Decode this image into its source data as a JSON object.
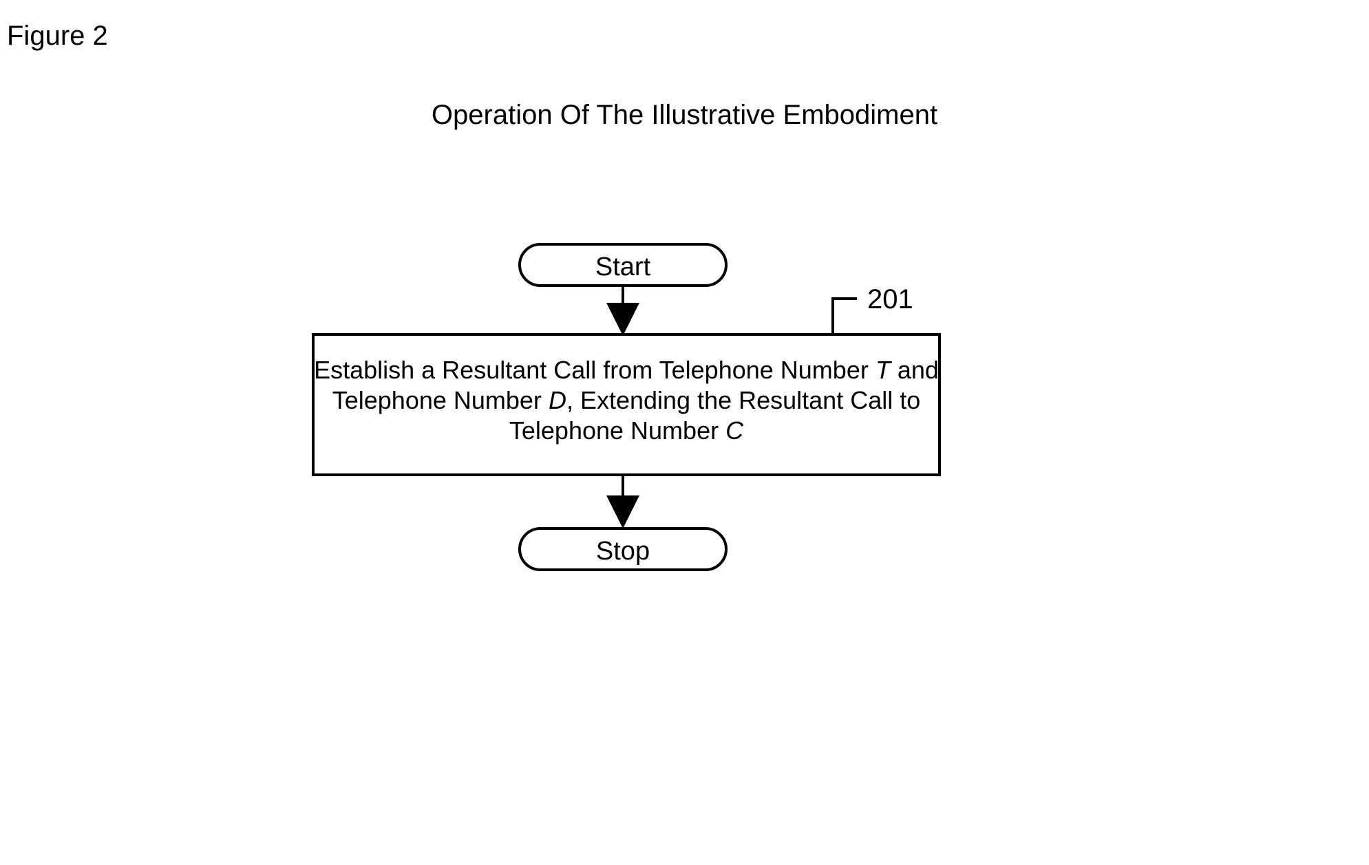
{
  "figure_label": "Figure 2",
  "title": "Operation Of The Illustrative Embodiment",
  "start": "Start",
  "stop": "Stop",
  "reference": "201",
  "step": {
    "line1_a": "Establish a Resultant Call from Telephone Number ",
    "var_T": "T",
    "line1_b": " and",
    "line2_a": "Telephone Number ",
    "var_D": "D",
    "line2_b": ", Extending the Resultant Call to",
    "line3_a": "Telephone Number ",
    "var_C": "C"
  }
}
